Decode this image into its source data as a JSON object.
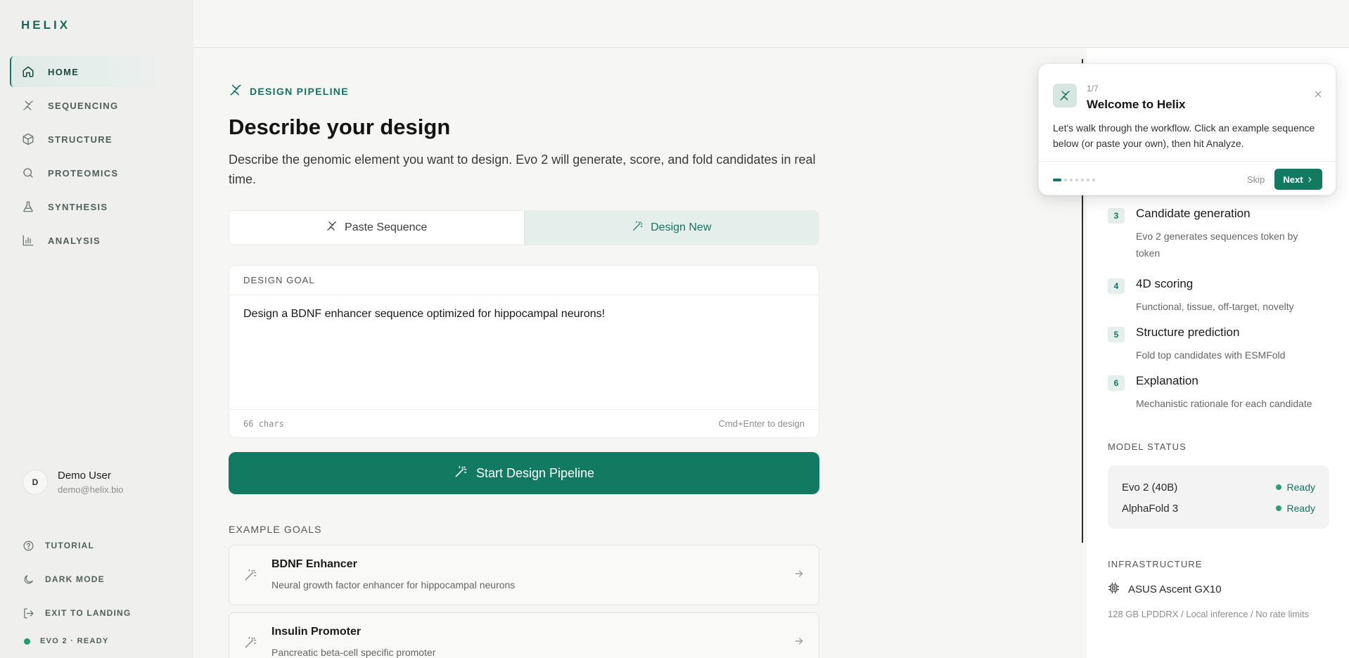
{
  "brand": {
    "logo": "HELIX",
    "accent": "#127a60"
  },
  "sidebar": {
    "items": [
      {
        "label": "HOME",
        "icon": "home-icon",
        "active": true
      },
      {
        "label": "SEQUENCING",
        "icon": "dna-icon"
      },
      {
        "label": "STRUCTURE",
        "icon": "cube-icon"
      },
      {
        "label": "PROTEOMICS",
        "icon": "search-icon"
      },
      {
        "label": "SYNTHESIS",
        "icon": "flask-icon"
      },
      {
        "label": "ANALYSIS",
        "icon": "bar-chart-icon"
      }
    ],
    "user": {
      "initial": "D",
      "name": "Demo User",
      "email": "demo@helix.bio"
    },
    "footer": {
      "tutorial": "TUTORIAL",
      "dark_mode": "DARK MODE",
      "exit": "EXIT TO LANDING",
      "status": "EVO 2 · READY"
    }
  },
  "main": {
    "eyebrow": "DESIGN PIPELINE",
    "title": "Describe your design",
    "description": "Describe the genomic element you want to design. Evo 2 will generate, score, and fold candidates in real time.",
    "tabs": [
      {
        "label": "Paste Sequence",
        "icon": "dna-icon"
      },
      {
        "label": "Design New",
        "icon": "magic-wand-icon",
        "active": true
      }
    ],
    "goal": {
      "label": "DESIGN GOAL",
      "text": "Design a BDNF enhancer sequence optimized for hippocampal neurons!",
      "chars": "66 chars",
      "hint": "Cmd+Enter to design"
    },
    "start_button": "Start Design Pipeline",
    "examples_label": "EXAMPLE GOALS",
    "examples": [
      {
        "title": "BDNF Enhancer",
        "subtitle": "Neural growth factor enhancer for hippocampal neurons"
      },
      {
        "title": "Insulin Promoter",
        "subtitle": "Pancreatic beta-cell specific promoter"
      }
    ]
  },
  "right_panel": {
    "steps": [
      {
        "num": "3",
        "title": "Candidate generation",
        "desc": "Evo 2 generates sequences token by token"
      },
      {
        "num": "4",
        "title": "4D scoring",
        "desc": "Functional, tissue, off-target, novelty"
      },
      {
        "num": "5",
        "title": "Structure prediction",
        "desc": "Fold top candidates with ESMFold"
      },
      {
        "num": "6",
        "title": "Explanation",
        "desc": "Mechanistic rationale for each candidate"
      }
    ],
    "model_status_label": "MODEL STATUS",
    "models": [
      {
        "name": "Evo 2 (40B)",
        "status": "Ready"
      },
      {
        "name": "AlphaFold 3",
        "status": "Ready"
      }
    ],
    "infrastructure_label": "INFRASTRUCTURE",
    "infrastructure": {
      "name": "ASUS Ascent GX10",
      "details": "128 GB LPDDRX / Local inference / No rate limits"
    }
  },
  "tour_popup": {
    "step": "1/7",
    "title": "Welcome to Helix",
    "text": "Let's walk through the workflow. Click an example sequence below (or paste your own), then hit Analyze.",
    "skip": "Skip",
    "next": "Next",
    "progress_current": 1,
    "progress_total": 7
  }
}
